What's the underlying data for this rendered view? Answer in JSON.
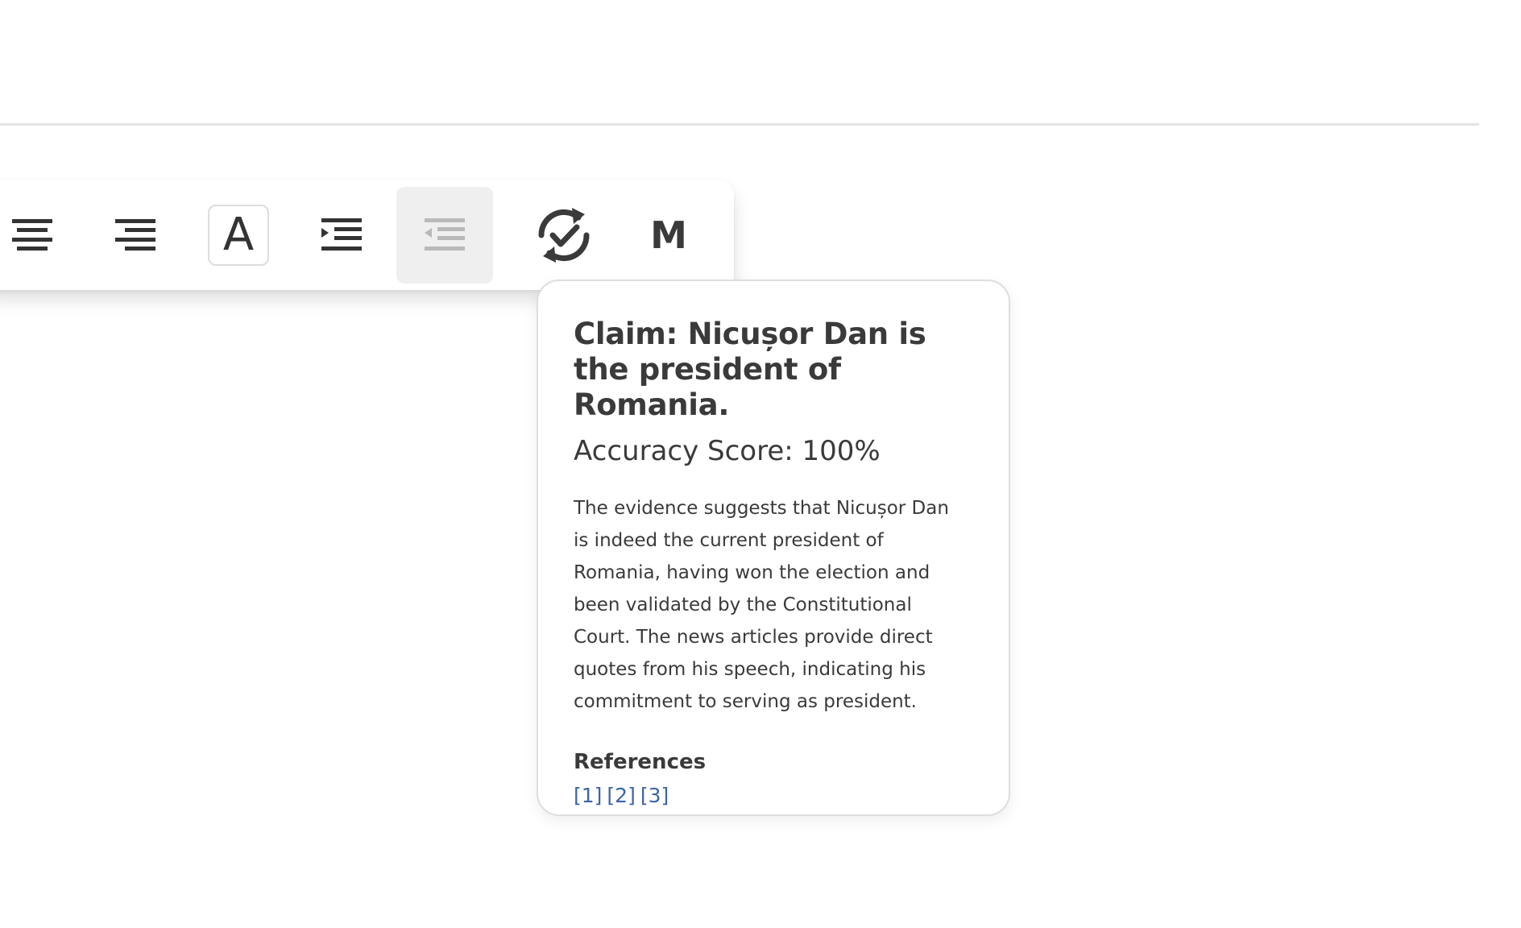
{
  "toolbar": {
    "buttons": [
      {
        "name": "align-center-icon"
      },
      {
        "name": "align-right-icon"
      },
      {
        "name": "font-icon",
        "glyph": "A"
      },
      {
        "name": "indent-icon"
      },
      {
        "name": "outdent-icon",
        "active": true
      },
      {
        "name": "refresh-check-icon"
      },
      {
        "name": "letter-m-icon",
        "glyph": "M"
      }
    ]
  },
  "factcheck": {
    "claim": "Claim: Nicușor Dan is the president of Romania.",
    "accuracy": "Accuracy Score: 100%",
    "explanation": "The evidence suggests that Nicușor Dan is indeed the current president of Romania, having won the election and been validated by the Constitutional Court. The news articles provide direct quotes from his speech, indicating his commitment to serving as president.",
    "references_title": "References",
    "references": [
      "[1]",
      "[2]",
      "[3]"
    ]
  },
  "colors": {
    "link": "#3d64a6",
    "text": "#3a3a3a",
    "active_button_bg": "#efefef"
  }
}
